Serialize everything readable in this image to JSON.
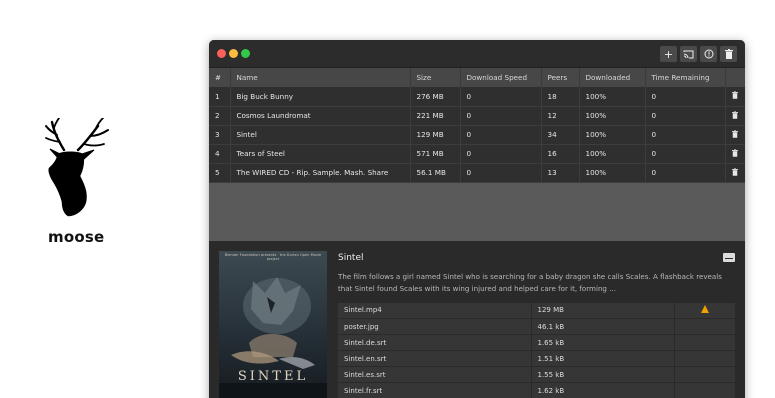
{
  "brand": {
    "name": "moose",
    "logo_icon": "deer-head-icon"
  },
  "window": {
    "traffic_lights": {
      "close": "#fc605b",
      "minimize": "#fdbc40",
      "zoom": "#34c84a"
    },
    "toolbar": [
      {
        "icon": "plus-icon",
        "symbol": "+"
      },
      {
        "icon": "cast-icon"
      },
      {
        "icon": "info-icon",
        "symbol": "!"
      },
      {
        "icon": "trash-icon"
      }
    ]
  },
  "torrents": {
    "columns": [
      "#",
      "Name",
      "Size",
      "Download Speed",
      "Peers",
      "Downloaded",
      "Time Remaining"
    ],
    "rows": [
      {
        "num": "1",
        "name": "Big Buck Bunny",
        "size": "276 MB",
        "speed": "0",
        "peers": "18",
        "downloaded": "100%",
        "remaining": "0"
      },
      {
        "num": "2",
        "name": "Cosmos Laundromat",
        "size": "221 MB",
        "speed": "0",
        "peers": "12",
        "downloaded": "100%",
        "remaining": "0"
      },
      {
        "num": "3",
        "name": "Sintel",
        "size": "129 MB",
        "speed": "0",
        "peers": "34",
        "downloaded": "100%",
        "remaining": "0"
      },
      {
        "num": "4",
        "name": "Tears of Steel",
        "size": "571 MB",
        "speed": "0",
        "peers": "16",
        "downloaded": "100%",
        "remaining": "0"
      },
      {
        "num": "5",
        "name": "The WIRED CD - Rip. Sample. Mash. Share",
        "size": "56.1 MB",
        "speed": "0",
        "peers": "13",
        "downloaded": "100%",
        "remaining": "0"
      }
    ]
  },
  "detail": {
    "title": "Sintel",
    "description": "The film follows a girl named Sintel who is searching for a baby dragon she calls Scales. A flashback reveals that Sintel found Scales with its wing injured and helped care for it, forming ...",
    "poster": {
      "credit": "Blender Foundation presents · the Durian Open Movie project",
      "title": "SINTEL"
    },
    "subtitle_icon": "subtitles-icon",
    "files": [
      {
        "name": "Sintel.mp4",
        "size": "129 MB",
        "icon": "vlc-cone-icon"
      },
      {
        "name": "poster.jpg",
        "size": "46.1 kB"
      },
      {
        "name": "Sintel.de.srt",
        "size": "1.65 kB"
      },
      {
        "name": "Sintel.en.srt",
        "size": "1.51 kB"
      },
      {
        "name": "Sintel.es.srt",
        "size": "1.55 kB"
      },
      {
        "name": "Sintel.fr.srt",
        "size": "1.62 kB"
      }
    ]
  }
}
